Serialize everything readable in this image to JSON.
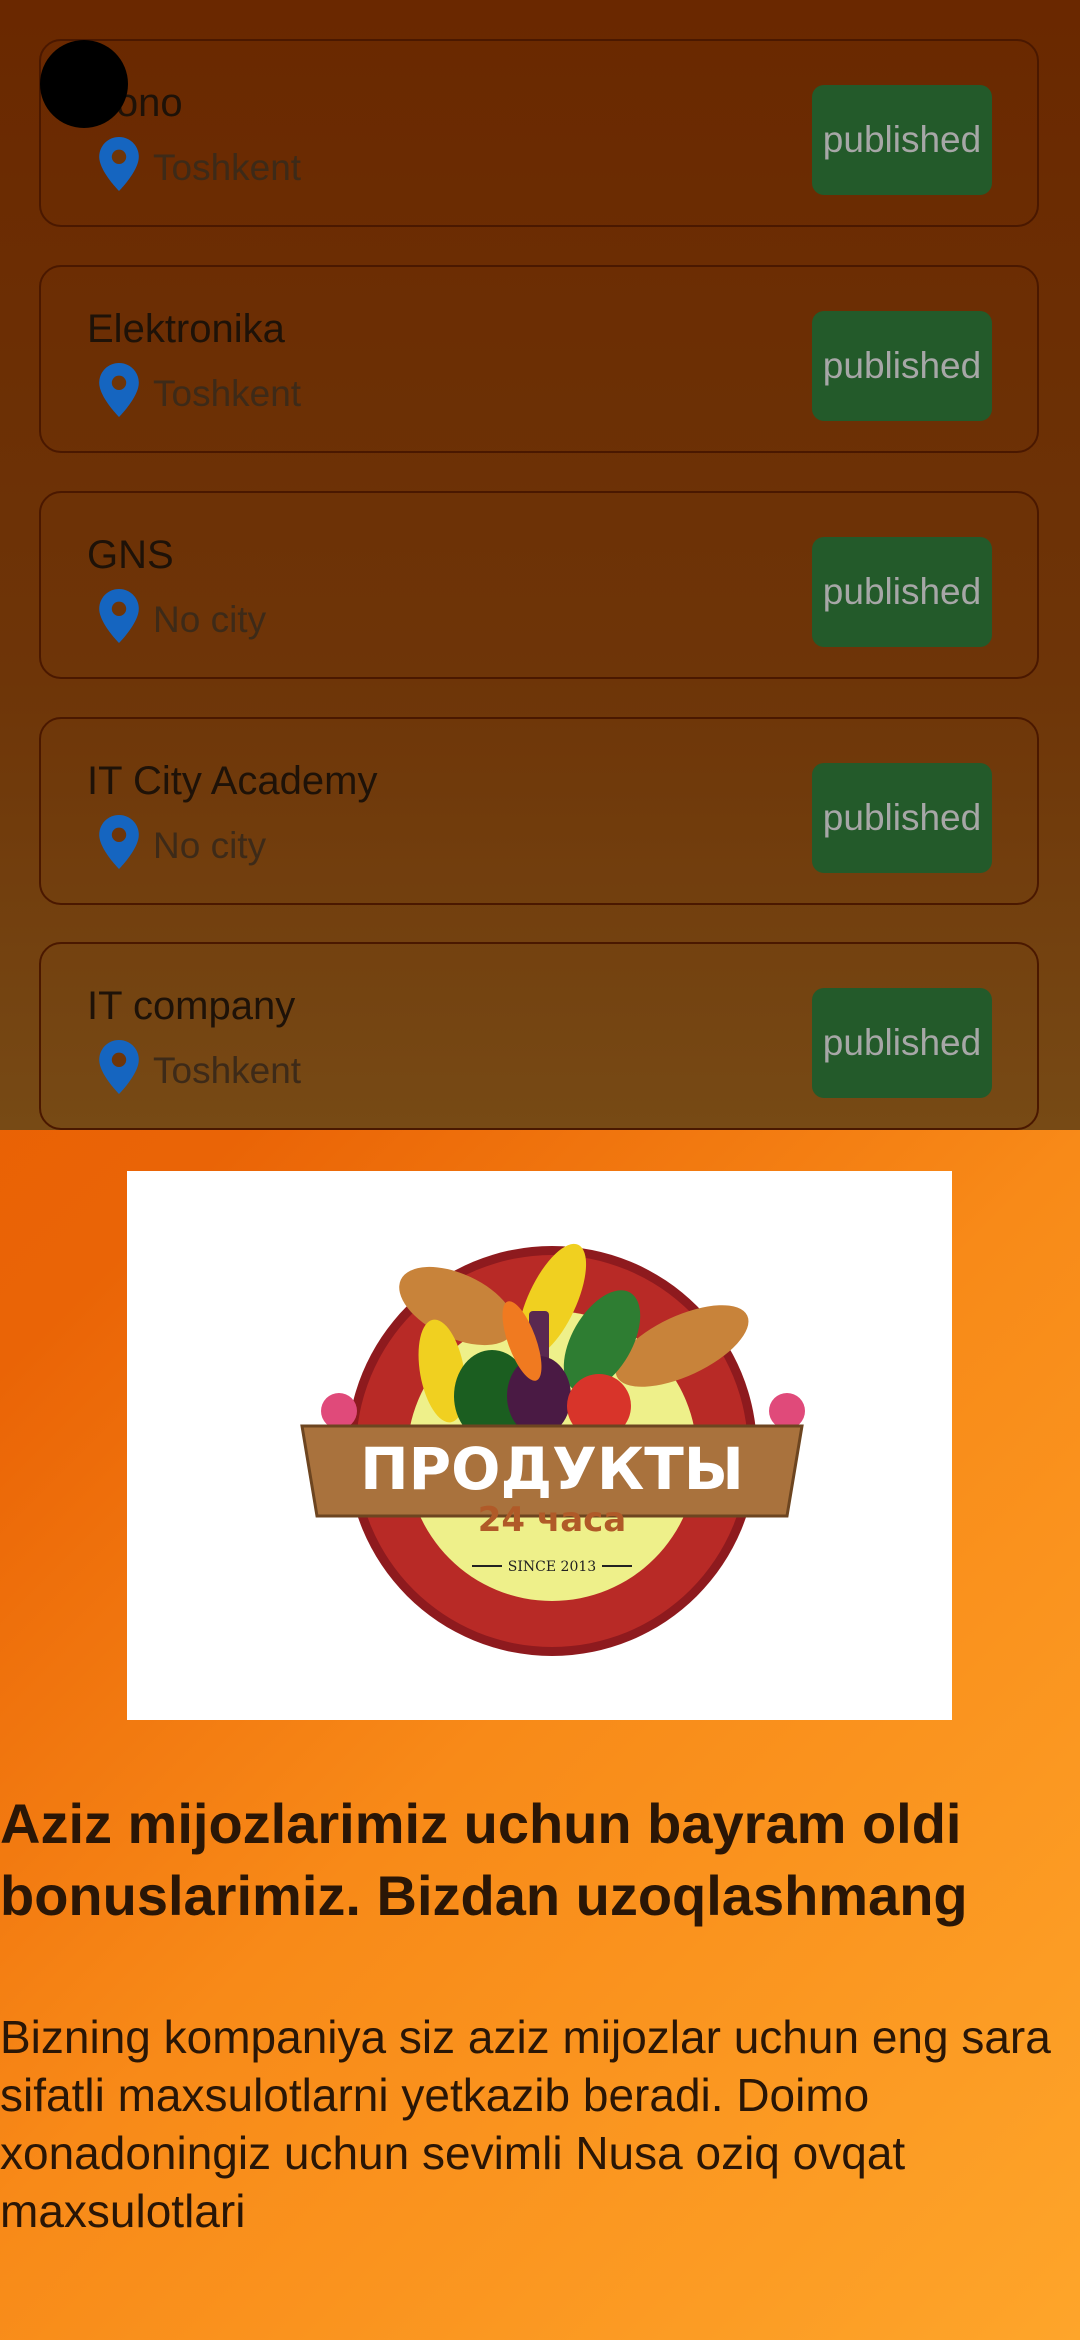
{
  "items": [
    {
      "title": "Nono",
      "city": "Toshkent",
      "status": "published"
    },
    {
      "title": "Elektronika",
      "city": "Toshkent",
      "status": "published"
    },
    {
      "title": "GNS",
      "city": "No city",
      "status": "published"
    },
    {
      "title": "IT City Academy",
      "city": "No city",
      "status": "published"
    },
    {
      "title": "IT company",
      "city": "Toshkent",
      "status": "published"
    }
  ],
  "promo": {
    "logo_title": "ПРОДУКТЫ",
    "logo_subtitle": "24 часа",
    "logo_since": "SINCE 2013",
    "headline": "Aziz mijozlarimiz uchun bayram oldi bonuslarimiz. Bizdan uzoqlashmang",
    "body": "Bizning kompaniya siz aziz mijozlar uchun eng sara sifatli maxsulotlarni yetkazib beradi.  Doimo xonadoningiz uchun sevimli Nusa oziq ovqat maxsulotlari"
  },
  "colors": {
    "badge_bg": "#235a2a",
    "pin_icon": "#1565c0",
    "accent_orange": "#e65a00"
  },
  "icons": {
    "location": "map-pin-icon",
    "avatar": "avatar-circle"
  }
}
